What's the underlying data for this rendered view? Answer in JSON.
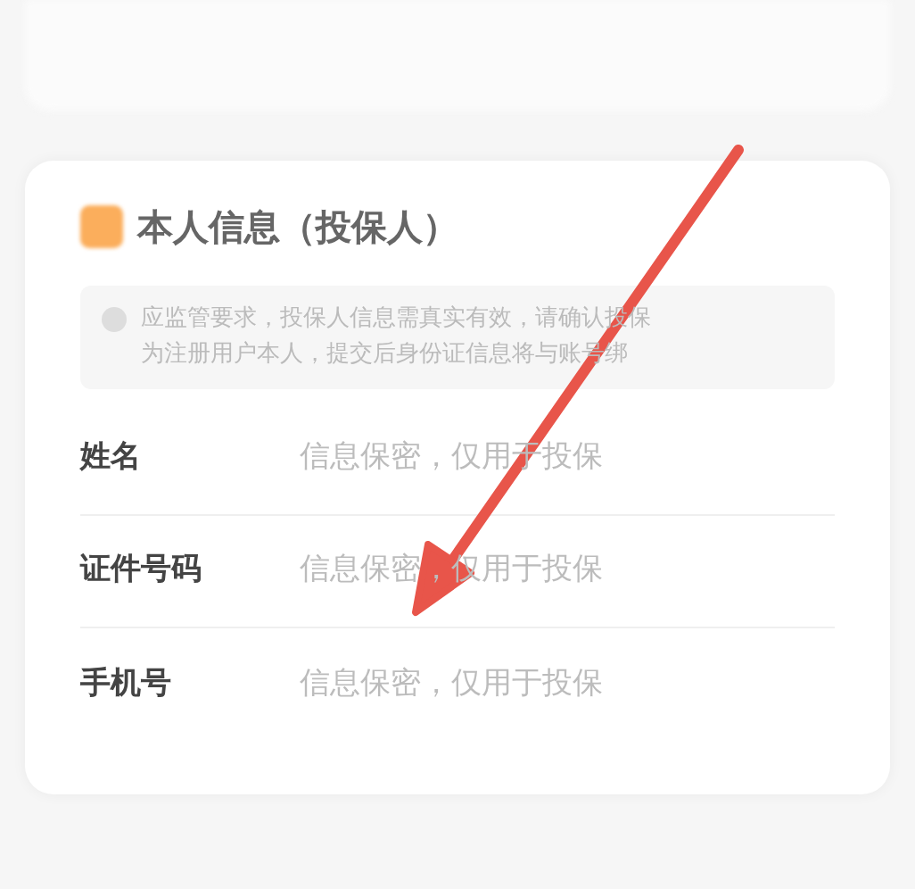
{
  "section": {
    "title": "本人信息（投保人）",
    "notice": [
      "应监管要求，投保人信息需真实有效，请确认投保",
      "为注册用户本人，提交后身份证信息将与账号绑"
    ]
  },
  "fields": [
    {
      "label": "姓名",
      "placeholder": "信息保密，仅用于投保"
    },
    {
      "label": "证件号码",
      "placeholder": "信息保密，仅用于投保"
    },
    {
      "label": "手机号",
      "placeholder": "信息保密，仅用于投保"
    }
  ]
}
